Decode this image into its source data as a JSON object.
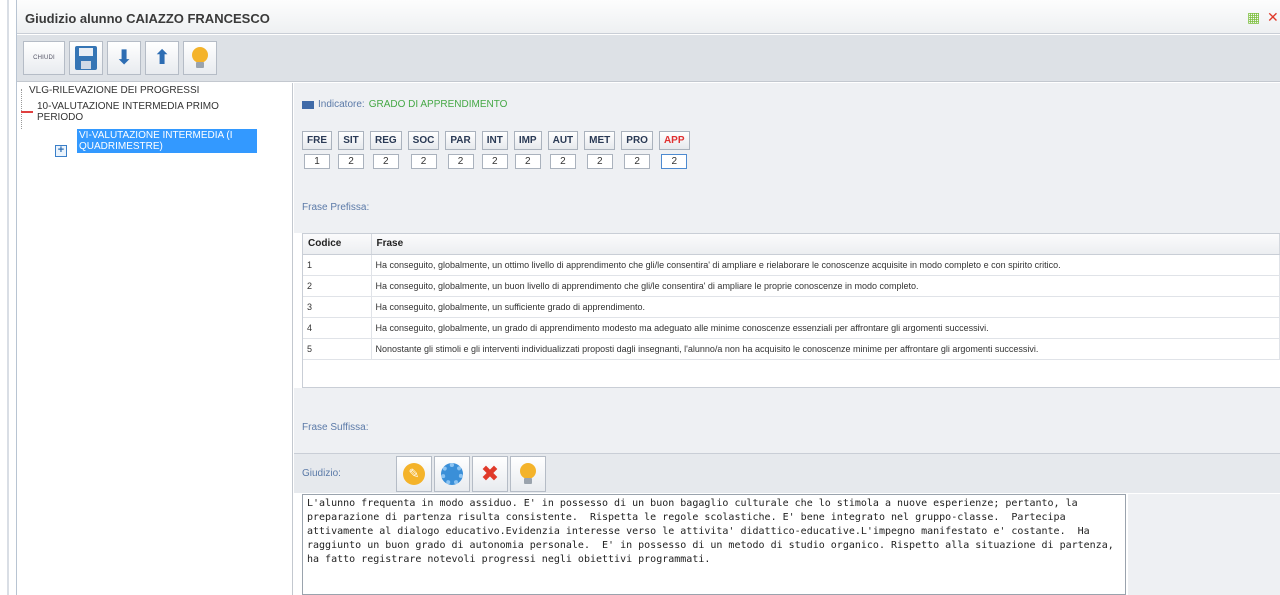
{
  "window": {
    "title": "Giudizio alunno CAIAZZO FRANCESCO"
  },
  "toolbar": {
    "close_label": "CHIUDI",
    "icons": [
      "save-icon",
      "arrow-down-icon",
      "arrow-up-icon",
      "bulb-icon"
    ]
  },
  "tree": {
    "root": "VLG-RILEVAZIONE DEI PROGRESSI",
    "child": "10-VALUTAZIONE INTERMEDIA PRIMO PERIODO",
    "selected": "VI-VALUTAZIONE INTERMEDIA (I QUADRIMESTRE)"
  },
  "indicator": {
    "label": "Indicatore:",
    "value": "GRADO DI APPRENDIMENTO"
  },
  "codes": [
    {
      "code": "FRE",
      "value": "1"
    },
    {
      "code": "SIT",
      "value": "2"
    },
    {
      "code": "REG",
      "value": "2"
    },
    {
      "code": "SOC",
      "value": "2"
    },
    {
      "code": "PAR",
      "value": "2"
    },
    {
      "code": "INT",
      "value": "2"
    },
    {
      "code": "IMP",
      "value": "2"
    },
    {
      "code": "AUT",
      "value": "2"
    },
    {
      "code": "MET",
      "value": "2"
    },
    {
      "code": "PRO",
      "value": "2"
    },
    {
      "code": "APP",
      "value": "2"
    }
  ],
  "frase_prefissa": "Frase Prefissa:",
  "table": {
    "headers": [
      "Codice",
      "Frase"
    ],
    "rows": [
      [
        "1",
        "Ha conseguito, globalmente, un ottimo livello di apprendimento che gli/le consentira' di ampliare e rielaborare le conoscenze acquisite in modo completo e con spirito critico."
      ],
      [
        "2",
        "Ha conseguito, globalmente, un buon livello di apprendimento che gli/le consentira' di ampliare le proprie conoscenze in modo completo."
      ],
      [
        "3",
        "Ha conseguito, globalmente, un sufficiente grado di apprendimento."
      ],
      [
        "4",
        "Ha conseguito, globalmente, un grado di apprendimento modesto ma adeguato alle minime conoscenze essenziali per affrontare gli argomenti successivi."
      ],
      [
        "5",
        "Nonostante gli stimoli e gli interventi individualizzati proposti dagli insegnanti, l'alunno/a non ha acquisito le conoscenze minime per affrontare gli argomenti successivi."
      ]
    ]
  },
  "frase_suffissa": "Frase Suffissa:",
  "giudizio": {
    "label": "Giudizio:",
    "text": "L'alunno frequenta in modo assiduo. E' in possesso di un buon bagaglio culturale che lo stimola a nuove esperienze; pertanto, la preparazione di partenza risulta consistente.  Rispetta le regole scolastiche. E' bene integrato nel gruppo-classe.  Partecipa attivamente al dialogo educativo.Evidenzia interesse verso le attivita' didattico-educative.L'impegno manifestato e' costante.  Ha raggiunto un buon grado di autonomia personale.  E' in possesso di un metodo di studio organico. Rispetto alla situazione di partenza, ha fatto registrare notevoli progressi negli obiettivi programmati."
  },
  "colors": {
    "selection": "#3399ff",
    "indicator_value": "#45a845",
    "active_code": "#e03030"
  }
}
